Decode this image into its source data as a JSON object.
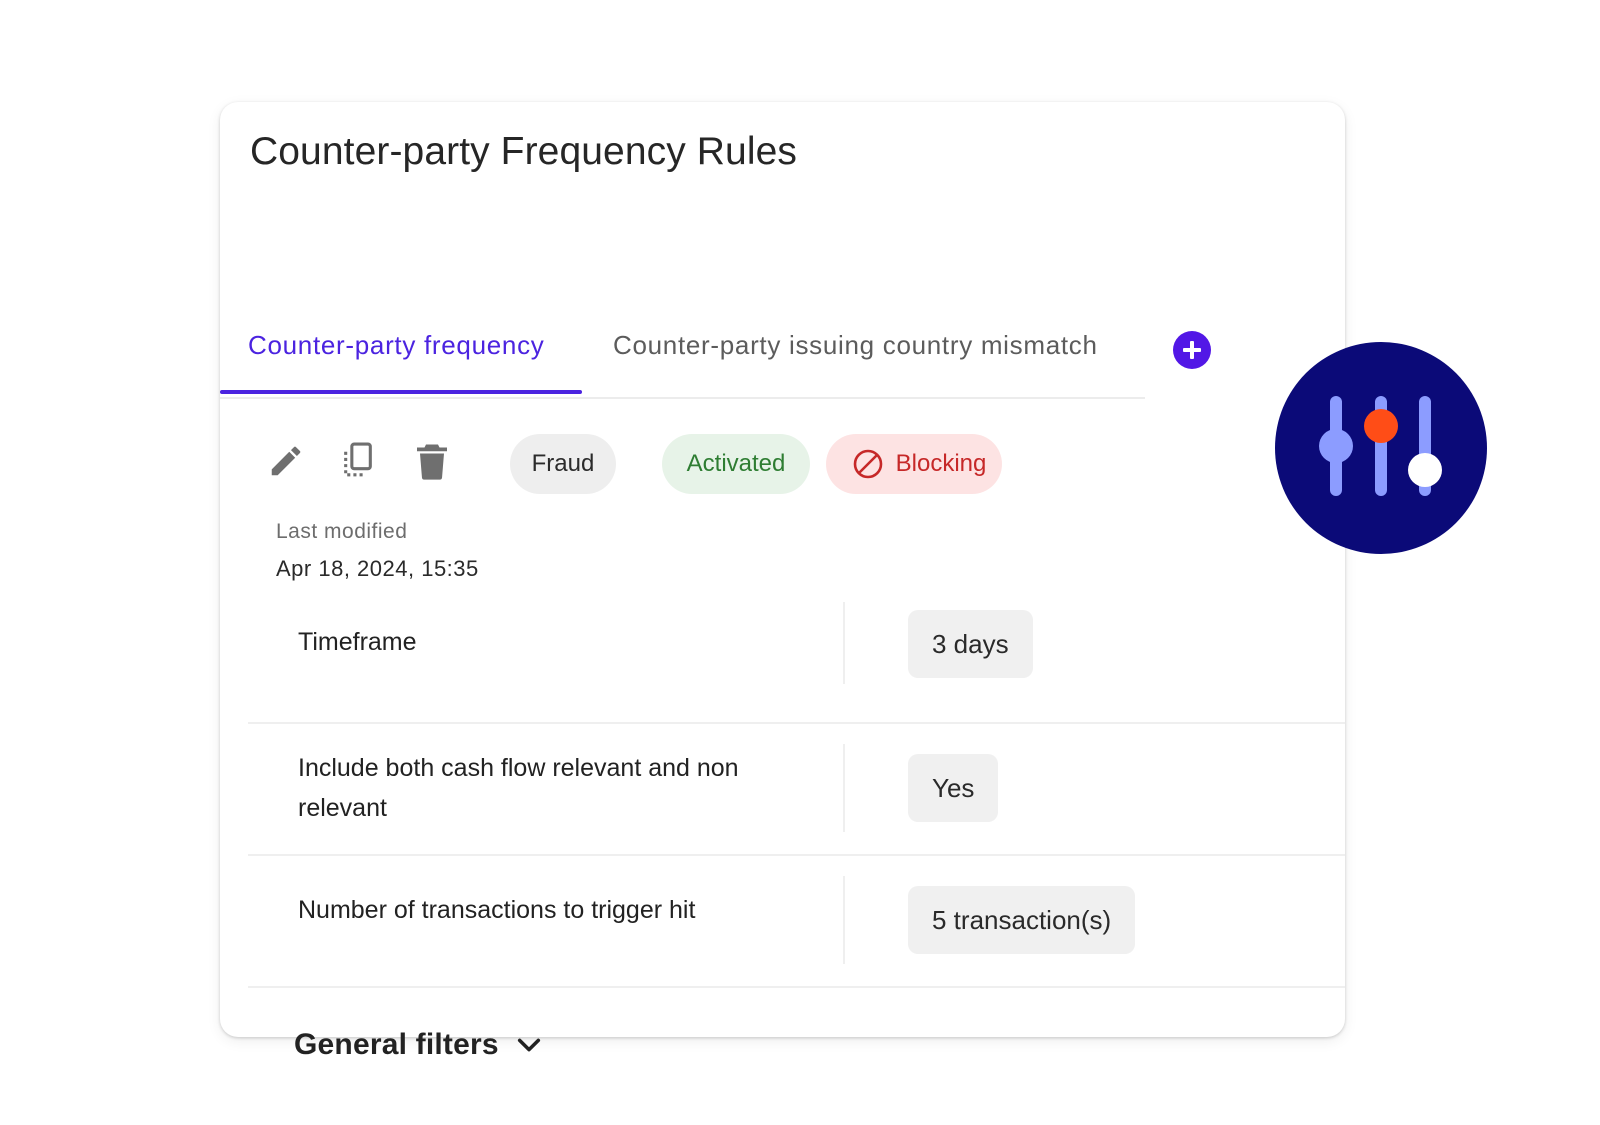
{
  "page": {
    "title": "Counter-party Frequency Rules"
  },
  "tabs": [
    {
      "label": "Counter-party frequency",
      "active": true
    },
    {
      "label": "Counter-party issuing country mismatch",
      "active": false
    }
  ],
  "toolbar": {
    "edit_icon": "pencil-icon",
    "copy_icon": "copy-icon",
    "delete_icon": "trash-icon",
    "add_tab_icon": "plus-icon"
  },
  "chips": {
    "category": "Fraud",
    "status": "Activated",
    "mode": "Blocking"
  },
  "meta": {
    "last_modified_label": "Last modified",
    "last_modified_value": "Apr 18, 2024, 15:35"
  },
  "rules": [
    {
      "label": "Timeframe",
      "value": "3 days"
    },
    {
      "label": "Include both cash flow relevant and non relevant",
      "value": "Yes"
    },
    {
      "label": "Number of transactions to trigger hit",
      "value": "5 transaction(s)"
    }
  ],
  "filters": {
    "label": "General filters",
    "expanded": false
  },
  "colors": {
    "accent": "#4b23e0",
    "add_button": "#5217e6",
    "activated_bg": "#e7f3e8",
    "activated_text": "#2e7d32",
    "blocking_bg": "#fde3e3",
    "blocking_text": "#c62828",
    "badge_bg": "#0b0a78",
    "slider_blue": "#8c9cff",
    "slider_orange": "#ff4d17"
  },
  "decoration": {
    "icon": "sliders-icon"
  }
}
